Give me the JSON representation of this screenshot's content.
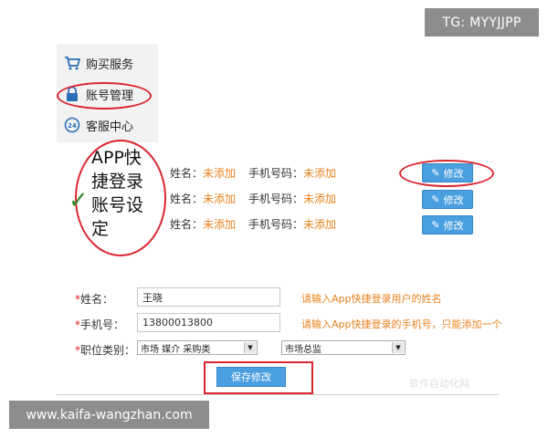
{
  "watermark_top": "TG: MYYJJPP",
  "watermark_bottom": "www.kaifa-wangzhan.com",
  "corner_watermark": "软件自动化网",
  "menu": {
    "items": [
      {
        "label": "购买服务",
        "icon": "cart-icon"
      },
      {
        "label": "账号管理",
        "icon": "lock-icon"
      },
      {
        "label": "客服中心",
        "icon": "24h-service-icon"
      }
    ]
  },
  "app_settings": {
    "title": "APP快捷登录账号设定",
    "check": "✓",
    "contacts": [
      {
        "name_label": "姓名：",
        "name_value": "未添加",
        "phone_label": "手机号码：",
        "phone_value": "未添加",
        "edit_label": "修改"
      },
      {
        "name_label": "姓名：",
        "name_value": "未添加",
        "phone_label": "手机号码：",
        "phone_value": "未添加",
        "edit_label": "修改"
      },
      {
        "name_label": "姓名：",
        "name_value": "未添加",
        "phone_label": "手机号码：",
        "phone_value": "未添加",
        "edit_label": "修改"
      }
    ]
  },
  "form": {
    "name": {
      "star": "*",
      "label": "姓名：",
      "value": "王晓",
      "hint": "请输入App快捷登录用户的姓名"
    },
    "phone": {
      "star": "*",
      "label": "手机号：",
      "value": "13800013800",
      "hint": "请输入App快捷登录的手机号，只能添加一个"
    },
    "position": {
      "star": "*",
      "label": "职位类别：",
      "select1": "市场 媒介 采购类",
      "select2": "市场总监"
    },
    "save_label": "保存修改"
  },
  "colors": {
    "accent_blue": "#4a9fe0",
    "annotation_red": "#d9262f",
    "placeholder_orange": "#e8821e"
  }
}
